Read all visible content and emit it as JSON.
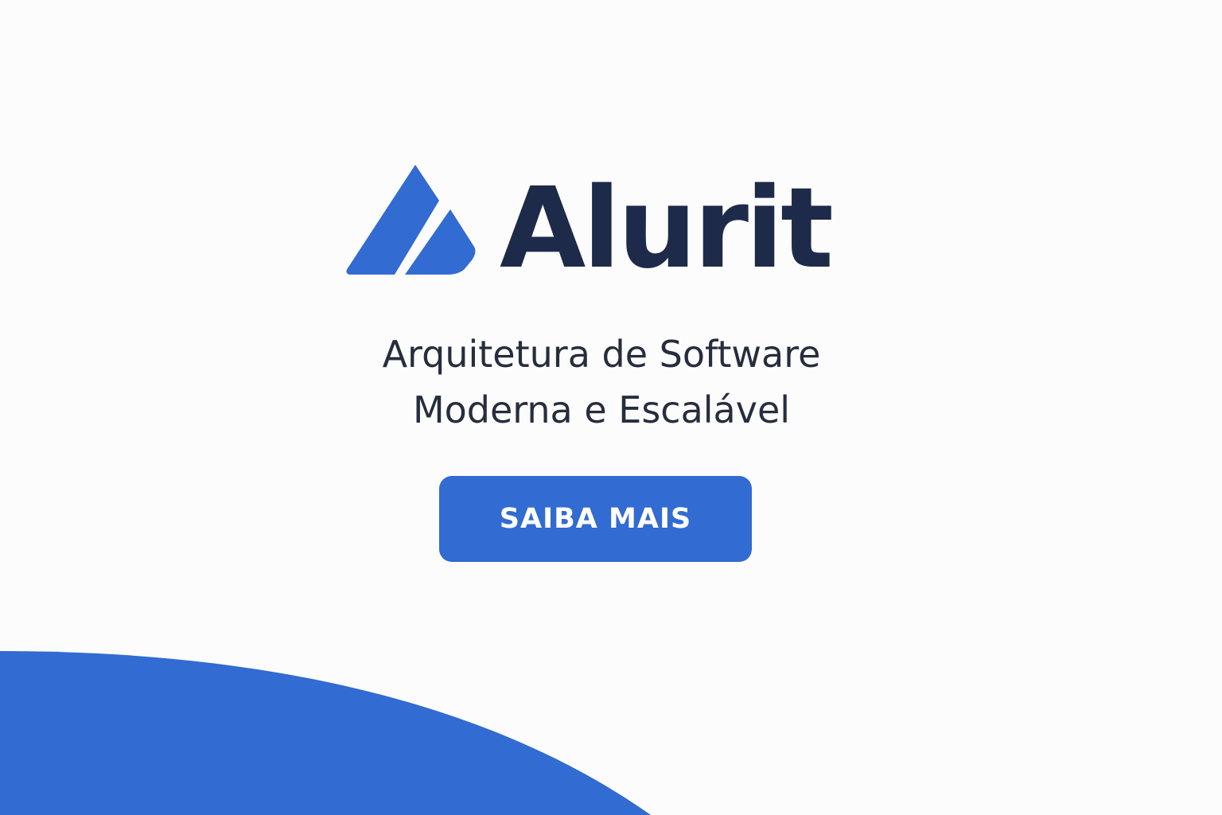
{
  "brand": {
    "name": "Alurit",
    "logo_icon": "triangle-logo-icon",
    "name_color": "#1e2a4a"
  },
  "tagline": {
    "line1": "Arquitetura de Software",
    "line2": "Moderna e Escalável"
  },
  "cta": {
    "label": "SAIBA MAIS"
  },
  "colors": {
    "accent": "#326bd1",
    "background": "#fcfcfc",
    "text": "#262d3d"
  }
}
